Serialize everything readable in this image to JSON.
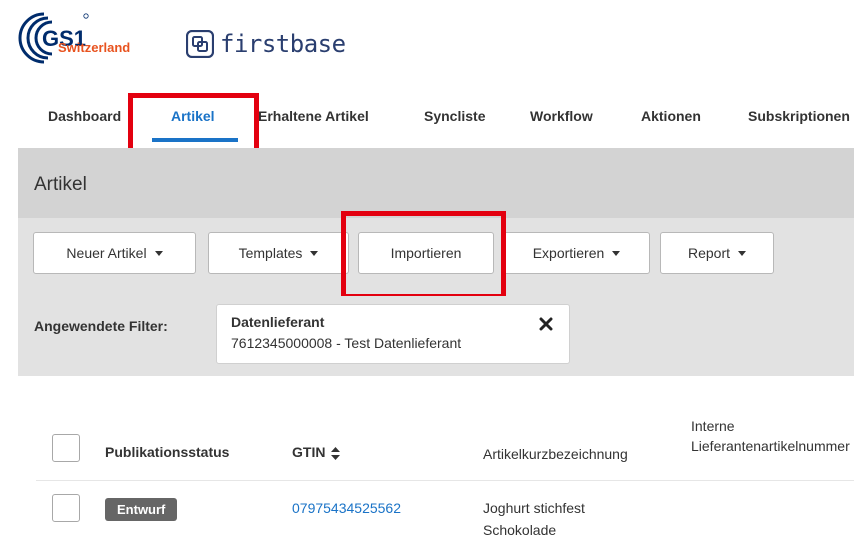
{
  "brand": {
    "gs1_region": "Switzerland",
    "firstbase_name": "firstbase",
    "colors": {
      "gs1_orange": "#e8531f",
      "gs1_navy": "#002c6c",
      "active_blue": "#1a73c7",
      "highlight_red": "#e3000f"
    }
  },
  "nav": {
    "items": [
      {
        "label": "Dashboard",
        "active": false
      },
      {
        "label": "Artikel",
        "active": true
      },
      {
        "label": "Erhaltene Artikel",
        "active": false
      },
      {
        "label": "Syncliste",
        "active": false
      },
      {
        "label": "Workflow",
        "active": false
      },
      {
        "label": "Aktionen",
        "active": false
      },
      {
        "label": "Subskriptionen",
        "active": false
      }
    ]
  },
  "page": {
    "title": "Artikel"
  },
  "toolbar": {
    "new_article": "Neuer Artikel",
    "templates": "Templates",
    "import": "Importieren",
    "export": "Exportieren",
    "report": "Report"
  },
  "filters": {
    "label": "Angewendete Filter:",
    "chip": {
      "title": "Datenlieferant",
      "value": "7612345000008 - Test Datenlieferant",
      "close_icon": "close-x-icon"
    }
  },
  "table": {
    "headers": {
      "status": "Publikationsstatus",
      "gtin": "GTIN",
      "short_name": "Artikelkurzbezeichnung",
      "internal_line1": "Interne",
      "internal_line2": "Lieferantenartikelnummer"
    },
    "rows": [
      {
        "status": "Entwurf",
        "gtin": "07975434525562",
        "short_name_line1": "Joghurt stichfest",
        "short_name_line2": "Schokolade"
      }
    ]
  }
}
